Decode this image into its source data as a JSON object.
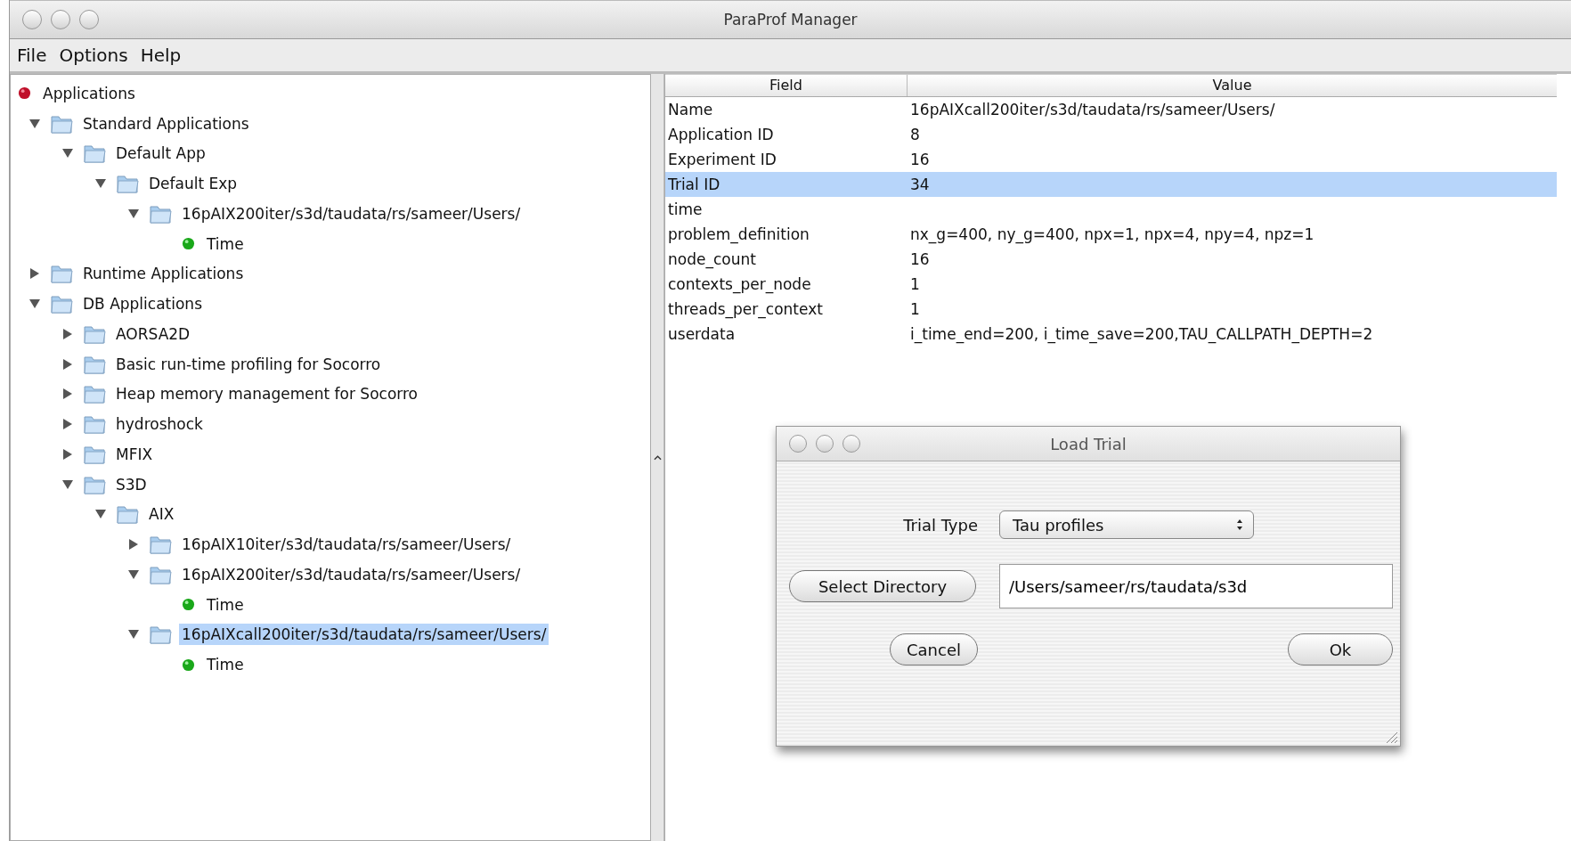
{
  "window": {
    "title": "ParaProf Manager"
  },
  "menu": [
    "File",
    "Options",
    "Help"
  ],
  "tree": [
    {
      "label": "Applications",
      "kind": "root",
      "selected": false,
      "children": [
        {
          "label": "Standard Applications",
          "kind": "folder",
          "expanded": true,
          "selected": false,
          "children": [
            {
              "label": "Default App",
              "kind": "folder",
              "expanded": true,
              "selected": false,
              "children": [
                {
                  "label": "Default Exp",
                  "kind": "folder",
                  "expanded": true,
                  "selected": false,
                  "children": [
                    {
                      "label": "16pAIX200iter/s3d/taudata/rs/sameer/Users/",
                      "kind": "folder",
                      "expanded": true,
                      "selected": false,
                      "children": [
                        {
                          "label": "Time",
                          "kind": "metric",
                          "selected": false
                        }
                      ]
                    }
                  ]
                }
              ]
            }
          ]
        },
        {
          "label": "Runtime Applications",
          "kind": "folder",
          "expanded": false,
          "selected": false
        },
        {
          "label": "DB Applications",
          "kind": "folder",
          "expanded": true,
          "selected": false,
          "children": [
            {
              "label": "AORSA2D",
              "kind": "folder",
              "expanded": false,
              "selected": false
            },
            {
              "label": "Basic run-time profiling for Socorro",
              "kind": "folder",
              "expanded": false,
              "selected": false
            },
            {
              "label": "Heap memory management for Socorro",
              "kind": "folder",
              "expanded": false,
              "selected": false
            },
            {
              "label": "hydroshock",
              "kind": "folder",
              "expanded": false,
              "selected": false
            },
            {
              "label": "MFIX",
              "kind": "folder",
              "expanded": false,
              "selected": false
            },
            {
              "label": "S3D",
              "kind": "folder",
              "expanded": true,
              "selected": false,
              "children": [
                {
                  "label": "AIX",
                  "kind": "folder",
                  "expanded": true,
                  "selected": false,
                  "children": [
                    {
                      "label": "16pAIX10iter/s3d/taudata/rs/sameer/Users/",
                      "kind": "folder",
                      "expanded": false,
                      "selected": false
                    },
                    {
                      "label": "16pAIX200iter/s3d/taudata/rs/sameer/Users/",
                      "kind": "folder",
                      "expanded": true,
                      "selected": false,
                      "children": [
                        {
                          "label": "Time",
                          "kind": "metric",
                          "selected": false
                        }
                      ]
                    },
                    {
                      "label": "16pAIXcall200iter/s3d/taudata/rs/sameer/Users/",
                      "kind": "folder",
                      "expanded": true,
                      "selected": true,
                      "children": [
                        {
                          "label": "Time",
                          "kind": "metric",
                          "selected": false
                        }
                      ]
                    }
                  ]
                }
              ]
            }
          ]
        }
      ]
    }
  ],
  "table": {
    "columns": [
      "Field",
      "Value"
    ],
    "rows": [
      {
        "field": "Name",
        "value": "16pAIXcall200iter/s3d/taudata/rs/sameer/Users/",
        "selected": false
      },
      {
        "field": "Application ID",
        "value": "8",
        "selected": false
      },
      {
        "field": "Experiment ID",
        "value": "16",
        "selected": false
      },
      {
        "field": "Trial ID",
        "value": "34",
        "selected": true
      },
      {
        "field": "time",
        "selected": false
      },
      {
        "field": "problem_definition",
        "value": "nx_g=400, ny_g=400, npx=1, npx=4, npy=4, npz=1",
        "selected": false
      },
      {
        "field": "node_count",
        "value": "16",
        "selected": false
      },
      {
        "field": "contexts_per_node",
        "value": "1",
        "selected": false
      },
      {
        "field": "threads_per_context",
        "value": "1",
        "selected": false
      },
      {
        "field": "userdata",
        "value": "i_time_end=200, i_time_save=200,TAU_CALLPATH_DEPTH=2",
        "selected": false
      }
    ]
  },
  "dialog": {
    "title": "Load Trial",
    "trial_type_label": "Trial Type",
    "trial_type": "Tau profiles",
    "select_button": "Select Directory",
    "directory": "/Users/sameer/rs/taudata/s3d",
    "cancel_button": "Cancel",
    "ok_button": "Ok"
  }
}
